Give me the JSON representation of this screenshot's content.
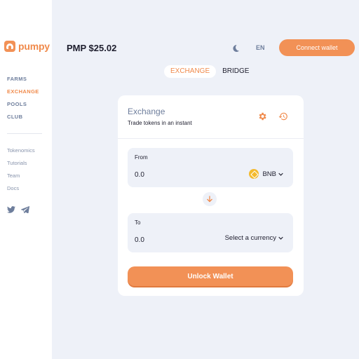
{
  "app": {
    "logo_text": "pumpy",
    "price": "PMP $25.02"
  },
  "header": {
    "language": "EN",
    "connect_label": "Connect wallet"
  },
  "sidebar": {
    "nav": [
      {
        "label": "FARMS",
        "active": false
      },
      {
        "label": "EXCHANGE",
        "active": true
      },
      {
        "label": "POOLS",
        "active": false
      },
      {
        "label": "CLUB",
        "active": false
      }
    ],
    "links": [
      "Tokenomics",
      "Tutorials",
      "Team",
      "Docs"
    ],
    "socials": [
      "twitter-icon",
      "telegram-icon"
    ]
  },
  "tabs": [
    {
      "label": "EXCHANGE",
      "active": true
    },
    {
      "label": "BRIDGE",
      "active": false
    }
  ],
  "exchange": {
    "title": "Exchange",
    "subtitle": "Trade tokens in an instant",
    "from": {
      "label": "From",
      "value": "0.0",
      "token": "BNB"
    },
    "to": {
      "label": "To",
      "value": "0.0",
      "token": "Select a currency"
    },
    "unlock_label": "Unlock Wallet"
  },
  "colors": {
    "accent": "#f29156",
    "background": "#eef1f8",
    "muted": "#6e7e9c"
  }
}
